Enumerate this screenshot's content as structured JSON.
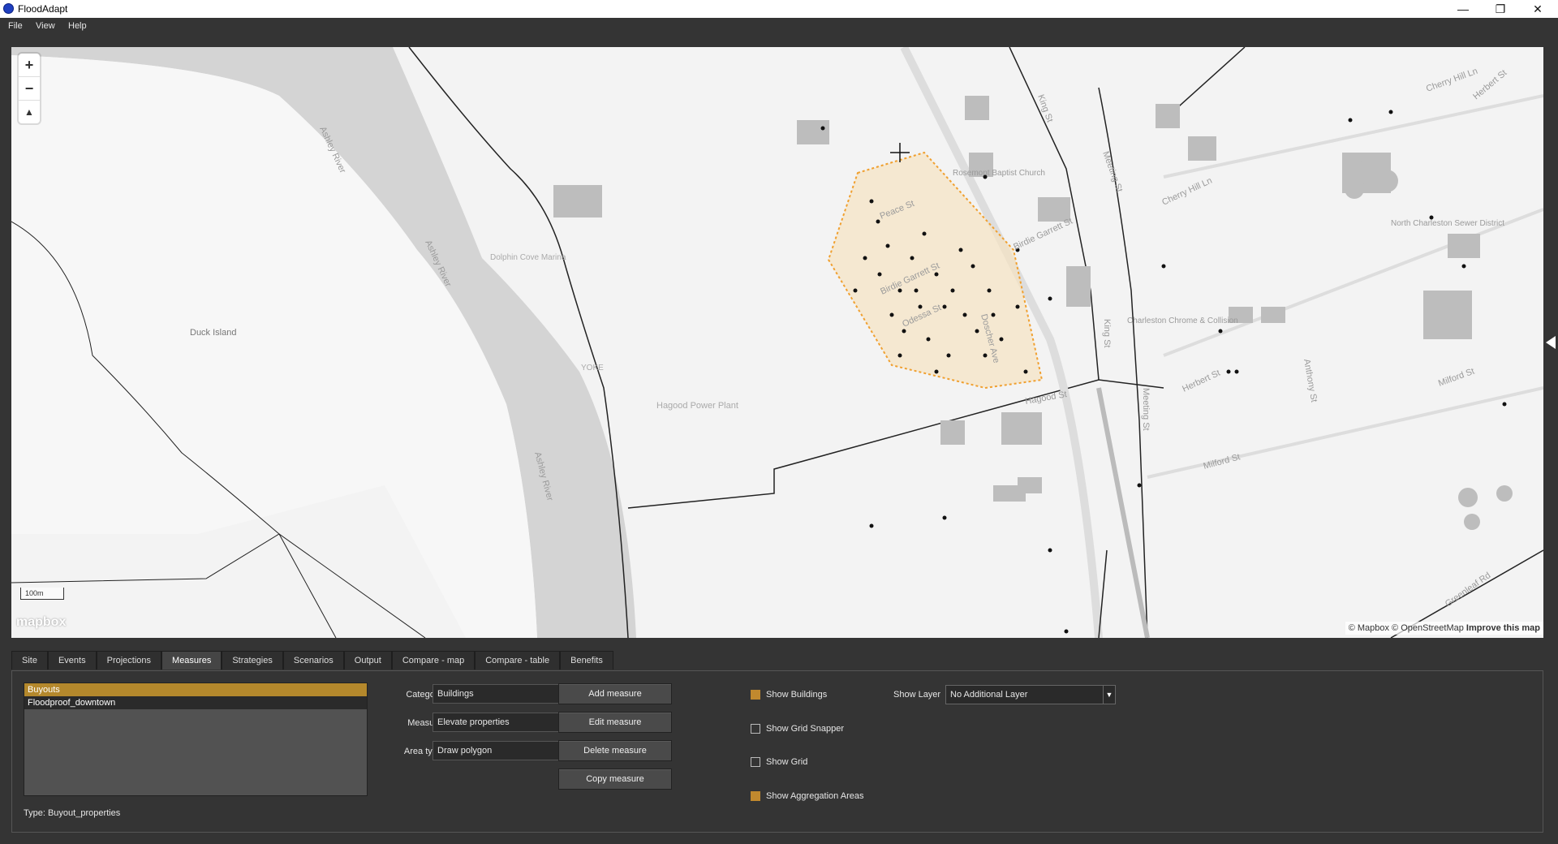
{
  "app": {
    "title": "FloodAdapt",
    "window_controls": [
      "minimize",
      "restore",
      "close"
    ]
  },
  "menu": {
    "items": [
      "File",
      "View",
      "Help"
    ]
  },
  "map": {
    "labels": {
      "ashley_river_1": "Ashley River",
      "ashley_river_2": "Ashley River",
      "ashley_river_3": "Ashley River",
      "duck_island": "Duck Island",
      "dolphin_cove": "Dolphin Cove Marina",
      "yoke": "YOKE",
      "hagood_power_plant": "Hagood Power Plant",
      "peace_st": "Peace St",
      "birdie_garrett_st_1": "Birdie Garrett St",
      "birdie_garrett_st_2": "Birdie Garrett St",
      "odessa_st": "Odessa St",
      "doscher_ave": "Doscher Ave",
      "king_st_1": "King St",
      "king_st_2": "King St",
      "meeting_st_1": "Meeting St",
      "meeting_st_2": "Meeting St",
      "hagood_st": "Hagood St",
      "herbert_st_1": "Herbert St",
      "herbert_st_2": "Herbert St",
      "cherry_hill_ln_1": "Cherry Hill Ln",
      "cherry_hill_ln_2": "Cherry Hill Ln",
      "anthony_st": "Anthony St",
      "milford_st_1": "Milford St",
      "milford_st_2": "Milford St",
      "greenleaf_rd": "Greenleaf Rd",
      "north_charleston_sewer": "North Charleston Sewer District",
      "charleston_chrome": "Charleston Chrome & Collision",
      "mount_baptist": "Rosemont Baptist Church"
    },
    "zoom_in": "+",
    "zoom_out": "−",
    "compass": "▲",
    "scale": "100m",
    "logo": "mapbox",
    "attribution": "© Mapbox © OpenStreetMap",
    "improve": "Improve this map",
    "polygon_color": "#f0a030"
  },
  "tabs": [
    "Site",
    "Events",
    "Projections",
    "Measures",
    "Strategies",
    "Scenarios",
    "Output",
    "Compare - map",
    "Compare - table",
    "Benefits"
  ],
  "active_tab": "Measures",
  "measures_panel": {
    "list": [
      "Buyouts",
      "Floodproof_downtown"
    ],
    "selected": "Buyouts",
    "type_label": "Type: Buyout_properties",
    "category_label": "Category",
    "category_value": "Buildings",
    "measure_label": "Measure",
    "measure_value": "Elevate properties",
    "area_type_label": "Area type",
    "area_type_value": "Draw polygon",
    "buttons": {
      "add": "Add measure",
      "edit": "Edit measure",
      "delete": "Delete measure",
      "copy": "Copy measure"
    },
    "checkboxes": {
      "show_buildings": "Show Buildings",
      "show_grid_snapper": "Show Grid Snapper",
      "show_grid": "Show Grid",
      "show_aggregation": "Show Aggregation Areas"
    },
    "show_layer_label": "Show Layer",
    "show_layer_value": "No Additional Layer",
    "accent_color": "#c1892e"
  }
}
